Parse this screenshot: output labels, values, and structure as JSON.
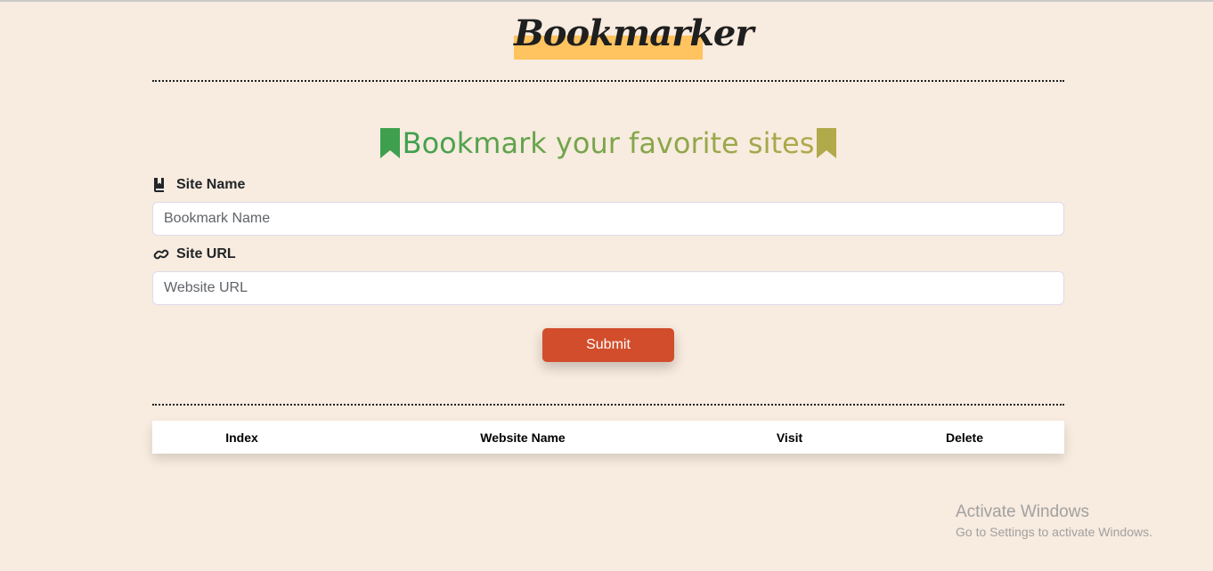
{
  "header": {
    "logo_text": "Bookmarker"
  },
  "form": {
    "heading": "Bookmark your favorite sites",
    "site_name_label": "Site Name",
    "site_name_placeholder": "Bookmark Name",
    "site_name_value": "",
    "site_url_label": "Site URL",
    "site_url_placeholder": "Website URL",
    "site_url_value": "",
    "submit_label": "Submit",
    "icons": {
      "heading_left": "bookmark-icon",
      "heading_right": "bookmark-icon",
      "site_name": "book-bookmark-icon",
      "site_url": "link-icon"
    }
  },
  "table": {
    "headers": [
      "Index",
      "Website Name",
      "Visit",
      "Delete"
    ],
    "rows": []
  },
  "watermark": {
    "line1": "Activate Windows",
    "line2": "Go to Settings to activate Windows."
  },
  "colors": {
    "page_background": "#f8ebdf",
    "logo_highlight": "#ffc45f",
    "submit_button": "#d24d2b",
    "heading_green": "#3ea04f",
    "heading_olive": "#b1a94a"
  }
}
